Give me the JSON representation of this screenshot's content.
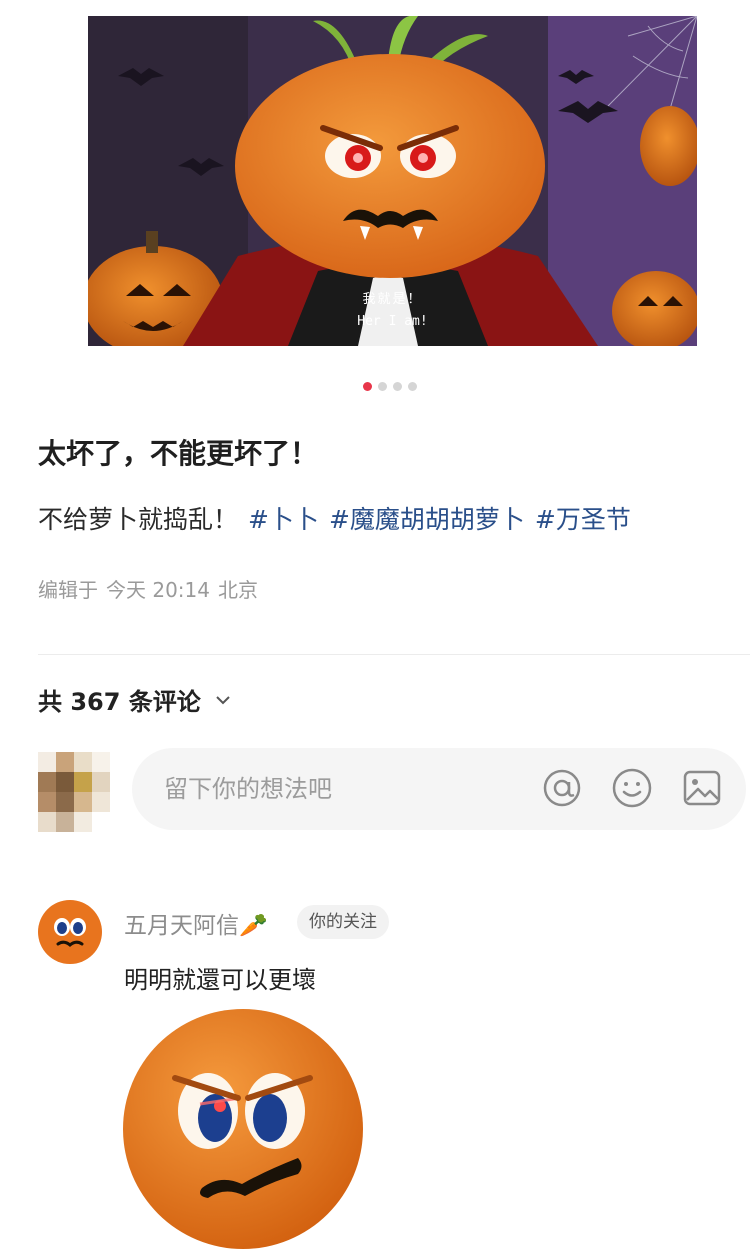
{
  "hero": {
    "subtitle_cn": "我就是！",
    "subtitle_en": "Her I am!"
  },
  "carousel": {
    "count": 4,
    "active_index": 0,
    "active_color": "#e8364a"
  },
  "post": {
    "title": "太坏了，不能更坏了！",
    "text": "不给萝卜就捣乱！",
    "tags": [
      "#卜卜",
      "#魔魔胡胡胡萝卜",
      "#万圣节"
    ],
    "edited_label": "编辑于",
    "edited_time": "今天 20:14",
    "location": "北京",
    "tag_color": "#2a4f8a"
  },
  "comments": {
    "count_label": "共 367 条评论",
    "input_placeholder": "留下你的想法吧",
    "input_icons": [
      "at-icon",
      "emoji-icon",
      "image-icon"
    ],
    "items": [
      {
        "author": "五月天阿信🥕",
        "badge": "你的关注",
        "text": "明明就還可以更壞"
      }
    ]
  }
}
